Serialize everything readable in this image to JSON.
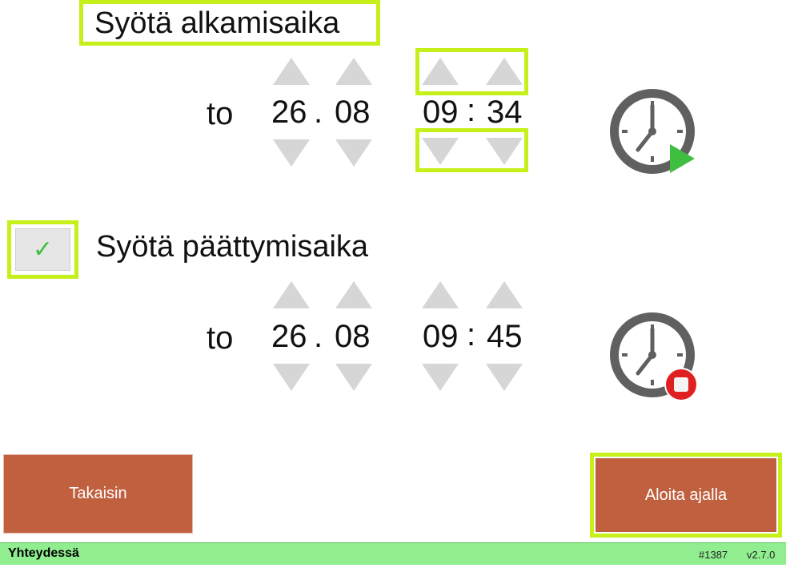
{
  "start": {
    "title": "Syötä alkamisaika",
    "day_name": "to",
    "day": "26",
    "date_sep": ".",
    "month": "08",
    "hour": "09",
    "time_sep": ":",
    "minute": "34"
  },
  "end": {
    "enabled": true,
    "checkmark": "✓",
    "title": "Syötä päättymisaika",
    "day_name": "to",
    "day": "26",
    "date_sep": ".",
    "month": "08",
    "hour": "09",
    "time_sep": ":",
    "minute": "45"
  },
  "buttons": {
    "back_label": "Takaisin",
    "start_label": "Aloita ajalla"
  },
  "status": {
    "text": "Yhteydessä",
    "id": "#1387",
    "version": "v2.7.0"
  },
  "icons": {
    "start_clock": "clock-play-icon",
    "end_clock": "clock-stop-icon"
  },
  "colors": {
    "highlight": "#c6f01a",
    "button": "#c0603f",
    "status_bar": "#90ee90",
    "arrow": "#d6d6d6",
    "clock": "#606060",
    "play": "#3fbf3f",
    "stop": "#e02020"
  }
}
